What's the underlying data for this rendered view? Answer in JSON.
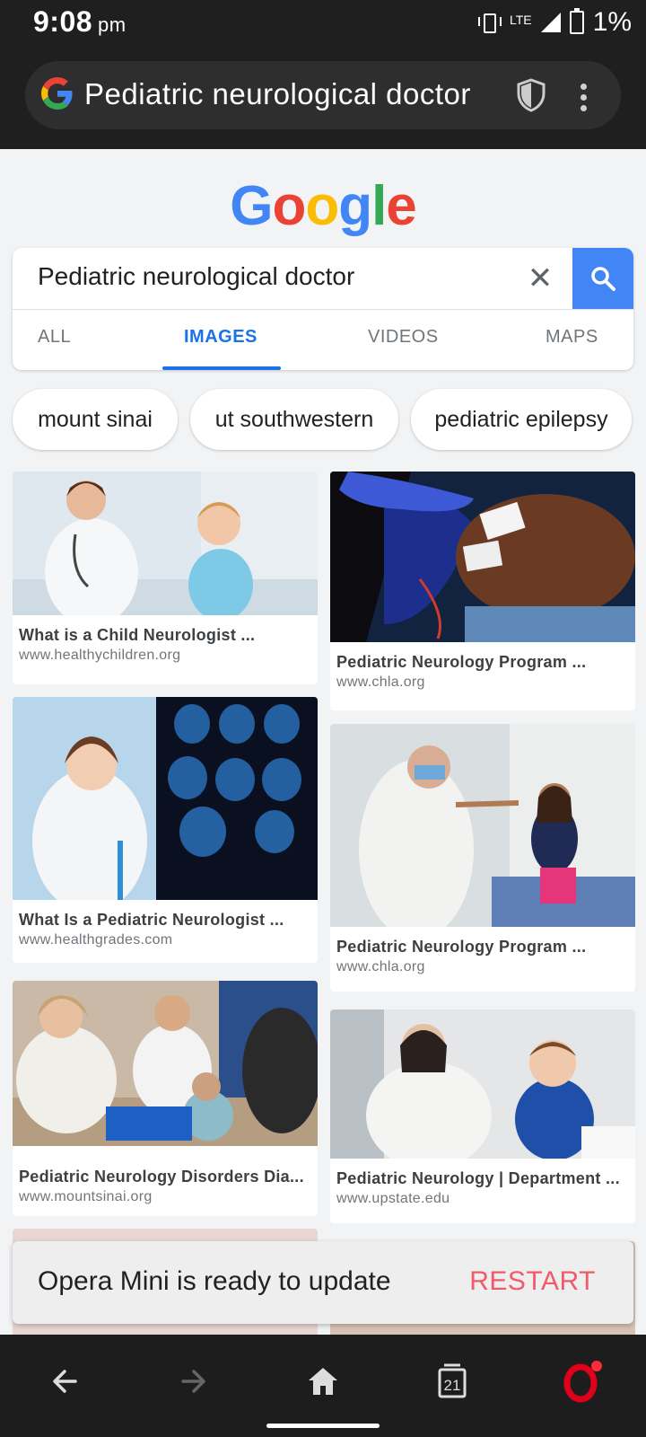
{
  "status_bar": {
    "time": "9:08",
    "ampm": "pm",
    "network": "LTE",
    "battery": "1%"
  },
  "address_bar": {
    "url": "Pediatric neurological doctor"
  },
  "google": {
    "logo_letters": [
      "G",
      "o",
      "o",
      "g",
      "l",
      "e"
    ],
    "query": "Pediatric neurological doctor",
    "tabs": [
      "ALL",
      "IMAGES",
      "VIDEOS",
      "MAPS"
    ],
    "active_tab": "IMAGES",
    "chips": [
      "mount sinai",
      "ut southwestern",
      "pediatric epilepsy"
    ]
  },
  "results": [
    {
      "title": "What is a Child Neurologist ...",
      "site": "www.healthychildren.org"
    },
    {
      "title": "What Is a Pediatric Neurologist ...",
      "site": "www.healthgrades.com"
    },
    {
      "title": "Pediatric Neurology Disorders Dia...",
      "site": "www.mountsinai.org"
    },
    {
      "title": "Pediatric Neurology Program ...",
      "site": "www.chla.org"
    },
    {
      "title": "Pediatric Neurology Program ...",
      "site": "www.chla.org"
    },
    {
      "title": "Pediatric Neurology | Department ...",
      "site": "www.upstate.edu"
    }
  ],
  "toast": {
    "message": "Opera Mini is ready to update",
    "action": "RESTART"
  },
  "nav": {
    "tabs_count": "21"
  },
  "colors": {
    "accent": "#1a73e8",
    "search_button": "#4285f4",
    "restart": "#f05b6b",
    "opera": "#e0001a"
  }
}
